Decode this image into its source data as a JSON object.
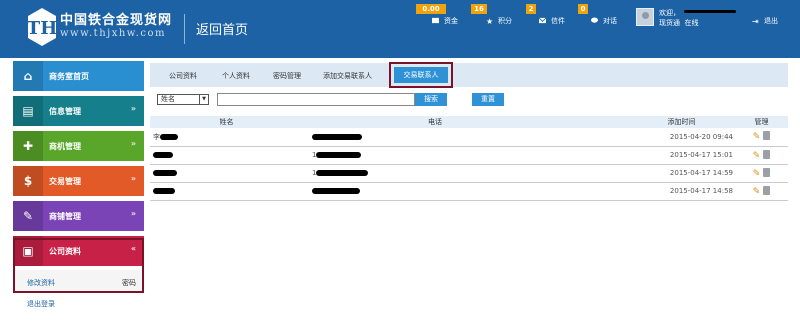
{
  "header": {
    "site_name": "中国铁合金现货网",
    "site_url": "www.thjxhw.com",
    "back_home": "返回首页",
    "items": [
      {
        "icon": "money-icon",
        "label": "资金",
        "badge": "0.00"
      },
      {
        "icon": "star-icon",
        "label": "积分",
        "badge": "16"
      },
      {
        "icon": "mail-icon",
        "label": "信件",
        "badge": "2"
      },
      {
        "icon": "chat-icon",
        "label": "对话",
        "badge": "0"
      }
    ],
    "welcome": "欢迎，",
    "account_type": "现货通",
    "status": "在线",
    "logout": "退出"
  },
  "sidebar": {
    "items": [
      {
        "label": "商务室首页",
        "icon": "home-icon"
      },
      {
        "label": "信息管理",
        "icon": "newspaper-icon"
      },
      {
        "label": "商机管理",
        "icon": "puzzle-icon"
      },
      {
        "label": "交易管理",
        "icon": "dollar-icon"
      },
      {
        "label": "商铺管理",
        "icon": "wand-icon"
      },
      {
        "label": "公司资料",
        "icon": "id-card-icon"
      }
    ],
    "submenu": {
      "edit": "修改资料",
      "password": "密码"
    },
    "logout": "退出登录"
  },
  "tabs": [
    "公司资料",
    "个人资料",
    "密码管理",
    "添加交易联系人",
    "交易联系人"
  ],
  "search": {
    "field_select": "姓名",
    "value": "",
    "search_button": "搜索",
    "reset_button": "重置"
  },
  "table": {
    "headers": [
      "姓名",
      "电话",
      "添加时间",
      "管理"
    ],
    "rows": [
      {
        "name": "李",
        "phone": "",
        "time": "2015-04-20 09:44"
      },
      {
        "name": "",
        "phone": "1",
        "time": "2015-04-17 15:01"
      },
      {
        "name": "",
        "phone": "1",
        "time": "2015-04-17 14:59"
      },
      {
        "name": "",
        "phone": "",
        "time": "2015-04-17 14:58"
      }
    ]
  },
  "colors": {
    "header_bg": "#1d62a5",
    "badge": "#f0a30a",
    "accent_blue": "#2f92d6",
    "highlight_border": "#7a1328"
  }
}
